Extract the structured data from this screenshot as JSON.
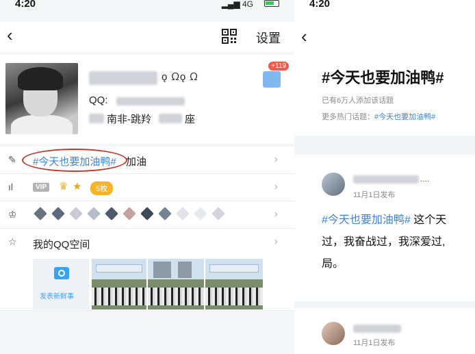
{
  "left_screen": {
    "status_time": "4:20",
    "status_signal": "4G",
    "nav": {
      "back_icon": "chevron-left-icon",
      "settings_label": "设置",
      "qr_icon": "qr-code-icon"
    },
    "profile": {
      "nick_symbols": "ǫ ᘯǫ ᘯ",
      "qq_label": "QQ:",
      "location_text": "南非-跳羚",
      "location_tail": "座",
      "gift_badge": "+119"
    },
    "rows": {
      "signature_tag": "#今天也要加油鸭#",
      "signature_tail": "加油",
      "vip_label": "VIP",
      "coins_label": "5枚",
      "space_title": "我的QQ空间",
      "post_button_label": "发表新鲜事"
    },
    "colors": {
      "accent": "#3b83d8",
      "annotation": "#c0392b",
      "coin": "#f9b327"
    }
  },
  "right_screen": {
    "status_time": "4:20",
    "topic_title": "#今天也要加油鸭#",
    "topic_subscribers": "已有6万人添加该话题",
    "hot_label": "更多热门话题：",
    "hot_tag": "#今天也要加油鸭#",
    "post1": {
      "ellipsis": "....",
      "date": "11月1日发布",
      "tag": "#今天也要加油鸭#",
      "text_tail": " 这个天",
      "line2": "过，我奋战过，我深爱过,",
      "line3": "局。"
    },
    "post2": {
      "date": "11月1日发布"
    }
  }
}
